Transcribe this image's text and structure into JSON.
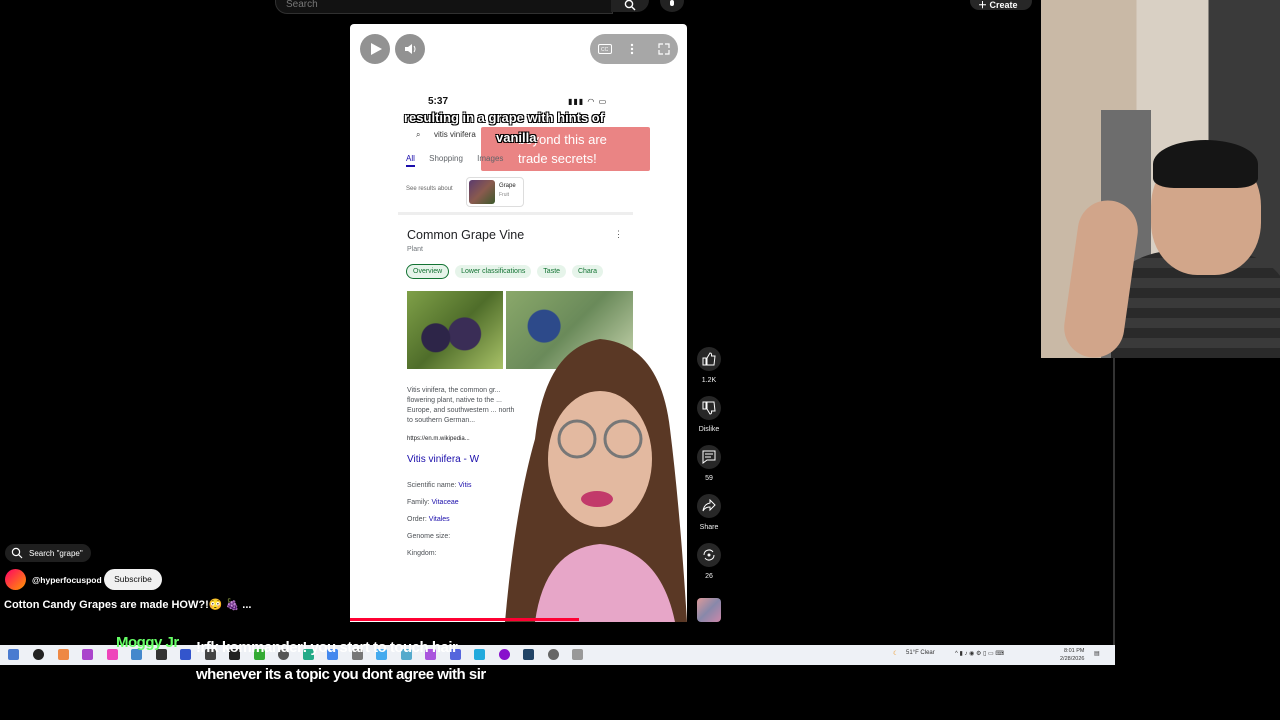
{
  "topbar": {
    "search_placeholder": "Search",
    "create_label": "Create"
  },
  "video": {
    "phone_time": "5:37",
    "caption_line1": "resulting in a grape with hints of",
    "caption_line2": "vanilla",
    "overlay_text_line1": "beyond this are",
    "overlay_text_line2": "trade secrets!",
    "search_query": "vitis vinifera",
    "tabs": [
      "All",
      "Shopping",
      "Images"
    ],
    "see_results": "See results about",
    "result_chip_title": "Grape",
    "result_chip_sub": "Fruit",
    "kp_title": "Common Grape Vine",
    "kp_subtitle": "Plant",
    "kp_chips": [
      "Overview",
      "Lower classifications",
      "Taste",
      "Chara"
    ],
    "snippet": "Vitis vinifera, the common gr... flowering plant, native to the ... Europe, and southwestern ... north to southern German...",
    "snippet_url": "https://en.m.wikipedia...",
    "snippet_link": "Vitis vinifera - W",
    "facts": [
      {
        "label": "Scientific name:",
        "value": "Vitis"
      },
      {
        "label": "Family:",
        "value": "Vitaceae"
      },
      {
        "label": "Order:",
        "value": "Vitales"
      },
      {
        "label": "Genome size:",
        "value": ""
      },
      {
        "label": "Kingdom:",
        "value": ""
      }
    ],
    "progress_fraction": 0.68
  },
  "actions": {
    "like_count": "1.2K",
    "dislike_label": "Dislike",
    "comment_count": "59",
    "share_label": "Share",
    "remix_count": "26"
  },
  "channel": {
    "search_pill": "Search \"grape\"",
    "handle": "@hyperfocuspod",
    "subscribe_label": "Subscribe",
    "title": "Cotton Candy Grapes are made HOW?!😳 🍇 ..."
  },
  "taskbar": {
    "weather": "51°F Clear",
    "time": "8:01 PM",
    "date": "2/28/2026"
  },
  "chat": {
    "username": "Moggy Jr",
    "message": "!rfk kommander! you start to touch hair whenever its a topic you dont agree with sir"
  }
}
